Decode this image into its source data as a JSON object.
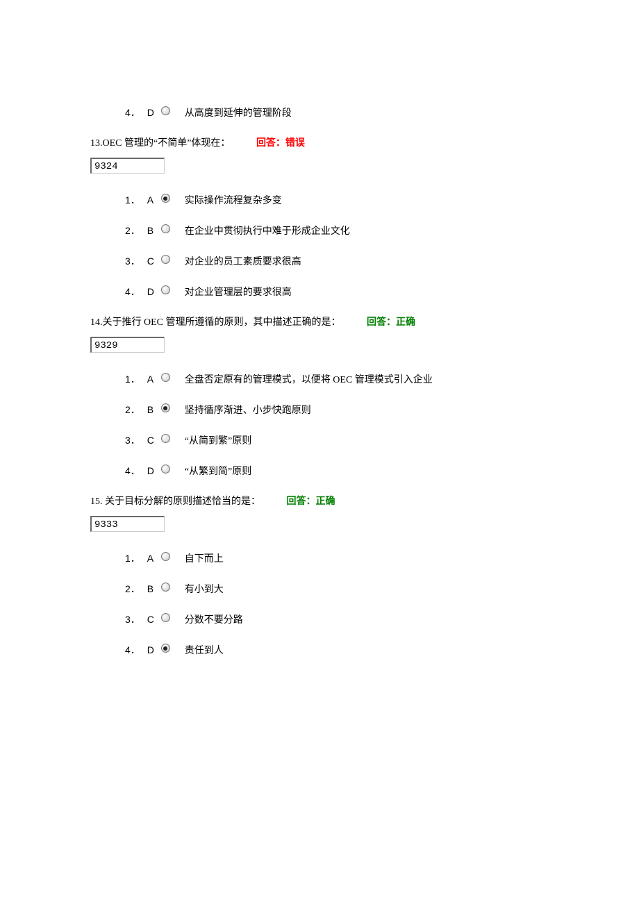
{
  "q12_partial": {
    "options": [
      {
        "num": "4．",
        "letter": "D",
        "text": "从高度到延伸的管理阶段",
        "selected": false
      }
    ]
  },
  "q13": {
    "number": "13.",
    "text": "OEC 管理的“不简单”体现在：",
    "answer_label": "回答：错误",
    "answer_status": "wrong",
    "id_value": "9324",
    "options": [
      {
        "num": "1．",
        "letter": "A",
        "text": "实际操作流程复杂多变",
        "selected": true
      },
      {
        "num": "2．",
        "letter": "B",
        "text": "在企业中贯彻执行中难于形成企业文化",
        "selected": false
      },
      {
        "num": "3．",
        "letter": "C",
        "text": "对企业的员工素质要求很高",
        "selected": false
      },
      {
        "num": "4．",
        "letter": "D",
        "text": "对企业管理层的要求很高",
        "selected": false
      }
    ]
  },
  "q14": {
    "number": "14.",
    "text": "关于推行 OEC 管理所遵循的原则，其中描述正确的是：",
    "answer_label": "回答：正确",
    "answer_status": "correct",
    "id_value": "9329",
    "options": [
      {
        "num": "1．",
        "letter": "A",
        "text": "全盘否定原有的管理模式，以便将 OEC 管理模式引入企业",
        "selected": false
      },
      {
        "num": "2．",
        "letter": "B",
        "text": "坚持循序渐进、小步快跑原则",
        "selected": true
      },
      {
        "num": "3．",
        "letter": "C",
        "text": "“从简到繁”原则",
        "selected": false
      },
      {
        "num": "4．",
        "letter": "D",
        "text": "“从繁到简”原则",
        "selected": false
      }
    ]
  },
  "q15": {
    "number": "15.",
    "text": " 关于目标分解的原则描述恰当的是：",
    "answer_label": "回答：正确",
    "answer_status": "correct",
    "id_value": "9333",
    "options": [
      {
        "num": "1．",
        "letter": "A",
        "text": "自下而上",
        "selected": false
      },
      {
        "num": "2．",
        "letter": "B",
        "text": "有小到大",
        "selected": false
      },
      {
        "num": "3．",
        "letter": "C",
        "text": "分数不要分路",
        "selected": false
      },
      {
        "num": "4．",
        "letter": "D",
        "text": "责任到人",
        "selected": true
      }
    ]
  }
}
